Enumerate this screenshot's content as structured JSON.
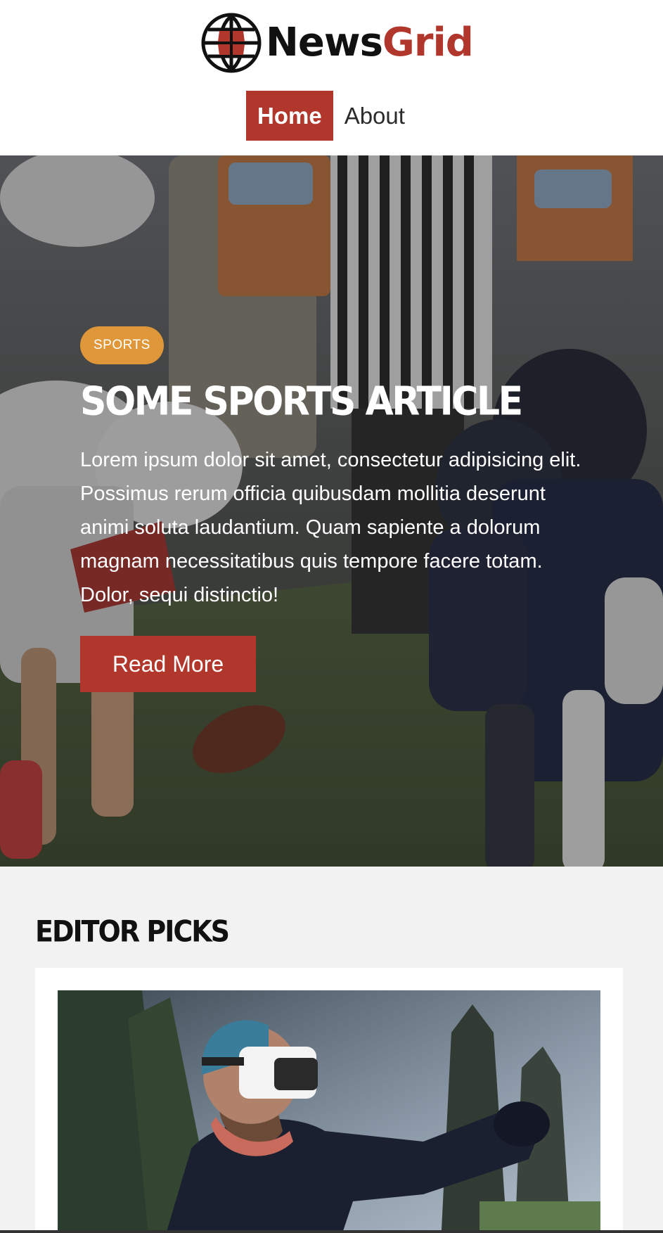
{
  "brand": {
    "name_part1": "News",
    "name_part2": "Grid",
    "colors": {
      "accent": "#b1372d",
      "dark": "#111111",
      "badge": "#e0973a"
    }
  },
  "nav": {
    "items": [
      {
        "label": "Home",
        "active": true
      },
      {
        "label": "About",
        "active": false
      }
    ]
  },
  "hero": {
    "category": "SPORTS",
    "title": "SOME SPORTS ARTICLE",
    "body": "Lorem ipsum dolor sit amet, consectetur adipisicing elit. Possimus rerum officia quibusdam mollitia deserunt animi soluta laudantium. Quam sapiente a dolorum magnam necessitatibus quis tempore facere totam. Dolor, sequi distinctio!",
    "button_label": "Read More",
    "image_icon": "football-lineup-photo"
  },
  "editor_picks": {
    "heading": "EDITOR PICKS",
    "cards": [
      {
        "image_icon": "vr-headset-photo"
      }
    ]
  }
}
